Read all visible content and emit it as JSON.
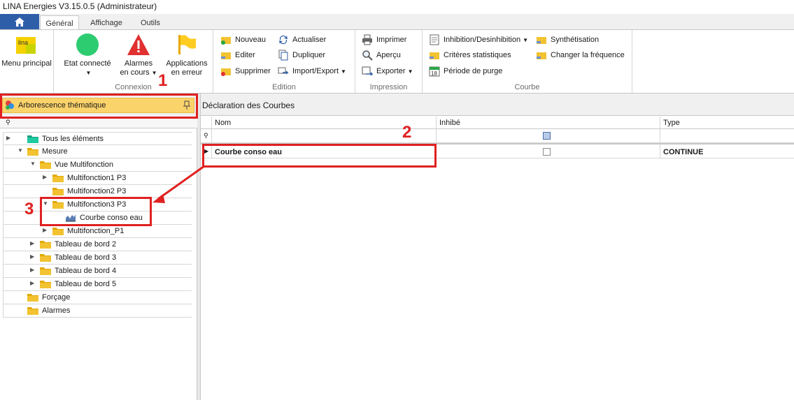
{
  "window": {
    "title": "LINA Energies  V3.15.0.5  (Administrateur)"
  },
  "tabs": [
    {
      "label": "Général",
      "active": true
    },
    {
      "label": "Affichage",
      "active": false
    },
    {
      "label": "Outils",
      "active": false
    }
  ],
  "ribbon": {
    "menu_principal": {
      "label": "Menu principal",
      "logo_text": "lina"
    },
    "connexion": {
      "label": "Connexion",
      "etat": {
        "label": "Etat connecté",
        "color": "#2ecc71"
      },
      "alarmes": {
        "line1": "Alarmes",
        "line2": "en cours",
        "color": "#e03030"
      },
      "applications": {
        "line1": "Applications",
        "line2": "en erreur"
      }
    },
    "edition": {
      "label": "Edition",
      "nouveau": "Nouveau",
      "editer": "Editer",
      "supprimer": "Supprimer",
      "actualiser": "Actualiser",
      "dupliquer": "Dupliquer",
      "import_export": "Import/Export"
    },
    "impression": {
      "label": "Impression",
      "imprimer": "Imprimer",
      "apercu": "Aperçu",
      "exporter": "Exporter"
    },
    "courbe": {
      "label": "Courbe",
      "inhibition": "Inhibition/Desinhibition",
      "criteres": "Critères statistiques",
      "periode": "Période de purge",
      "periode_day": "18",
      "synthetisation": "Synthétisation",
      "frequence": "Changer la fréquence"
    }
  },
  "left_panel": {
    "title": "Arborescence thématique",
    "tree": [
      {
        "label": "Tous les éléments",
        "level": 0,
        "expander": "",
        "icon": "folder-teal-icon"
      },
      {
        "label": "Mesure",
        "level": 0,
        "expander": "▼",
        "icon": "folder-icon"
      },
      {
        "label": "Vue Multifonction",
        "level": 1,
        "expander": "▼",
        "icon": "folder-icon"
      },
      {
        "label": "Multifonction1 P3",
        "level": 2,
        "expander": "▶",
        "icon": "folder-icon"
      },
      {
        "label": "Multifonction2 P3",
        "level": 2,
        "expander": "",
        "icon": "folder-icon"
      },
      {
        "label": "Multifonction3 P3",
        "level": 2,
        "expander": "▼",
        "icon": "folder-icon"
      },
      {
        "label": "Courbe conso eau",
        "level": 3,
        "expander": "",
        "icon": "chart-icon"
      },
      {
        "label": "Multifonction_P1",
        "level": 2,
        "expander": "▶",
        "icon": "folder-icon"
      },
      {
        "label": "Tableau de bord 2",
        "level": 1,
        "expander": "▶",
        "icon": "folder-icon"
      },
      {
        "label": "Tableau de bord 3",
        "level": 1,
        "expander": "▶",
        "icon": "folder-icon"
      },
      {
        "label": "Tableau de bord 4",
        "level": 1,
        "expander": "▶",
        "icon": "folder-icon"
      },
      {
        "label": "Tableau de bord 5",
        "level": 1,
        "expander": "▶",
        "icon": "folder-icon"
      },
      {
        "label": "Forçage",
        "level": 0,
        "expander": "",
        "icon": "folder-icon"
      },
      {
        "label": "Alarmes",
        "level": 0,
        "expander": "",
        "icon": "folder-icon"
      }
    ]
  },
  "right_panel": {
    "title": "Déclaration des Courbes",
    "columns": [
      "Nom",
      "Inhibé",
      "Type"
    ],
    "rows": [
      {
        "nom": "Courbe conso eau",
        "inhibe": false,
        "type": "CONTINUE"
      }
    ]
  },
  "annotations": {
    "n1": "1",
    "n2": "2",
    "n3": "3",
    "color": "#e02020"
  }
}
